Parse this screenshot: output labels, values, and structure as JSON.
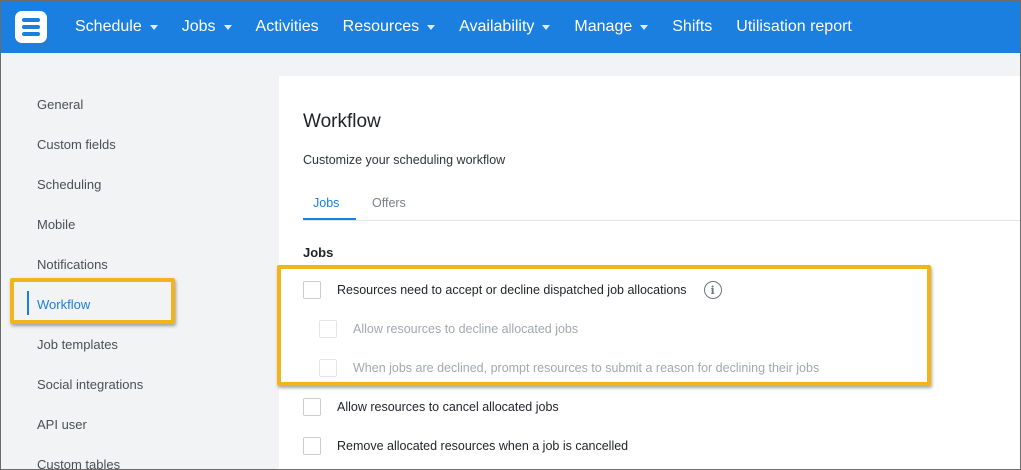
{
  "topnav": {
    "logo_icon": "app-logo-icon",
    "items": [
      {
        "label": "Schedule",
        "dropdown": true
      },
      {
        "label": "Jobs",
        "dropdown": true
      },
      {
        "label": "Activities",
        "dropdown": false
      },
      {
        "label": "Resources",
        "dropdown": true
      },
      {
        "label": "Availability",
        "dropdown": true
      },
      {
        "label": "Manage",
        "dropdown": true
      },
      {
        "label": "Shifts",
        "dropdown": false
      },
      {
        "label": "Utilisation report",
        "dropdown": false
      }
    ]
  },
  "sidebar": {
    "items": [
      {
        "label": "General"
      },
      {
        "label": "Custom fields"
      },
      {
        "label": "Scheduling"
      },
      {
        "label": "Mobile"
      },
      {
        "label": "Notifications"
      },
      {
        "label": "Workflow",
        "active": true
      },
      {
        "label": "Job templates"
      },
      {
        "label": "Social integrations"
      },
      {
        "label": "API user"
      },
      {
        "label": "Custom tables"
      }
    ]
  },
  "main": {
    "title": "Workflow",
    "subtitle": "Customize your scheduling workflow",
    "tabs": [
      {
        "label": "Jobs",
        "active": true
      },
      {
        "label": "Offers",
        "active": false
      }
    ],
    "section_heading": "Jobs",
    "options": [
      {
        "label": "Resources need to accept or decline dispatched job allocations",
        "checked": false,
        "disabled": false,
        "info_icon": "info-icon"
      },
      {
        "label": "Allow resources to decline allocated jobs",
        "checked": false,
        "disabled": true
      },
      {
        "label": "When jobs are declined, prompt resources to submit a reason for declining their jobs",
        "checked": false,
        "disabled": true
      },
      {
        "label": "Allow resources to cancel allocated jobs",
        "checked": false,
        "disabled": false
      },
      {
        "label": "Remove allocated resources when a job is cancelled",
        "checked": false,
        "disabled": false
      }
    ]
  },
  "colors": {
    "brand_blue": "#1a7fde",
    "highlight": "#f2b41b"
  }
}
